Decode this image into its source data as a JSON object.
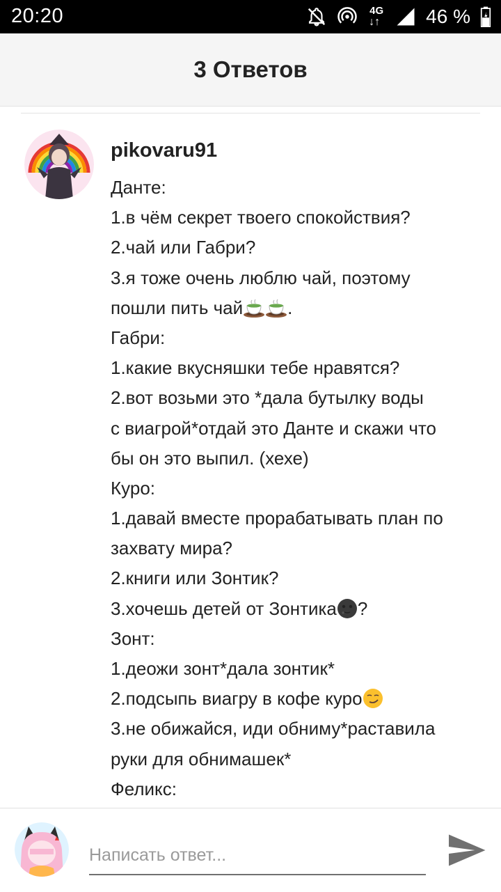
{
  "status_bar": {
    "time": "20:20",
    "network": "4G",
    "battery": "46 %",
    "icons": [
      "notifications-off-icon",
      "hotspot-icon",
      "network-4g-icon",
      "signal-icon",
      "battery-icon"
    ]
  },
  "header": {
    "title": "3 Ответов"
  },
  "comment": {
    "author": "pikovaru91",
    "avatar": "author-avatar",
    "lines": [
      "Данте:",
      "1.в чём секрет твоего спокойствия?",
      "2.чай или Габри?",
      "3.я тоже очень люблю чай, поэтому",
      "пошли пить чай",
      "Габри:",
      "1.какие вкусняшки тебе нравятся?",
      "2.вот возьми это *дала бутылку воды",
      "с виагрой*отдай это Данте и скажи что",
      "бы он это выпил. (хехе)",
      "Куро:",
      "1.давай вместе прорабатывать план по",
      "захвату мира?",
      "2.книги или Зонтик?",
      "3.хочешь детей от Зонтика",
      "Зонт:",
      "1.деожи зонт*дала зонтик*",
      "2.подсыпь виагру в кофе куро",
      "3.не обижайся, иди обниму*раставила",
      "руки для обнимашек*",
      "Феликс:"
    ],
    "line_tails": {
      "tea_line": ".",
      "moon_line": "?"
    }
  },
  "reply": {
    "placeholder": "Написать ответ...",
    "send_icon": "send-icon"
  },
  "colors": {
    "header_bg": "#f5f5f5",
    "text": "#222222",
    "placeholder": "#9a9a9a",
    "send": "#707070"
  }
}
